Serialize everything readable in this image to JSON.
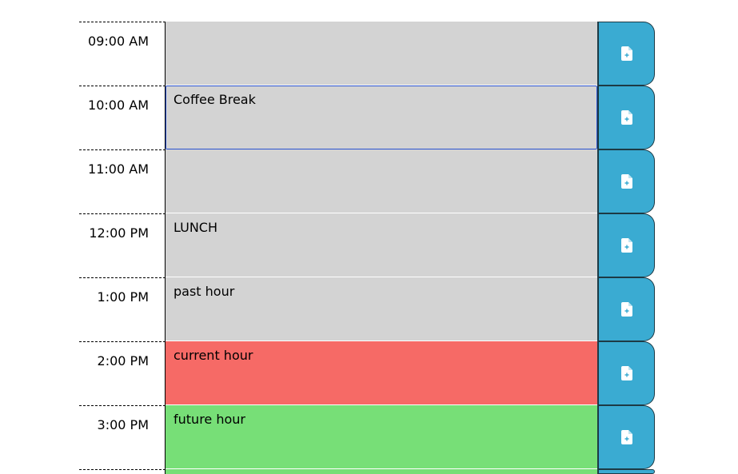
{
  "colors": {
    "past": "#d3d3d3",
    "present": "#f66a66",
    "future": "#77df77",
    "save_button": "#3aabd2"
  },
  "save_icon": "file-plus-icon",
  "time_blocks": [
    {
      "hour": "09:00 AM",
      "text": "",
      "state": "past"
    },
    {
      "hour": "10:00 AM",
      "text": "Coffee Break",
      "state": "past"
    },
    {
      "hour": "11:00 AM",
      "text": "",
      "state": "past"
    },
    {
      "hour": "12:00 PM",
      "text": "LUNCH",
      "state": "past"
    },
    {
      "hour": "1:00 PM",
      "text": "past hour",
      "state": "past"
    },
    {
      "hour": "2:00 PM",
      "text": "current hour",
      "state": "present"
    },
    {
      "hour": "3:00 PM",
      "text": "future hour",
      "state": "future"
    },
    {
      "hour": "",
      "text": "",
      "state": "future"
    }
  ]
}
